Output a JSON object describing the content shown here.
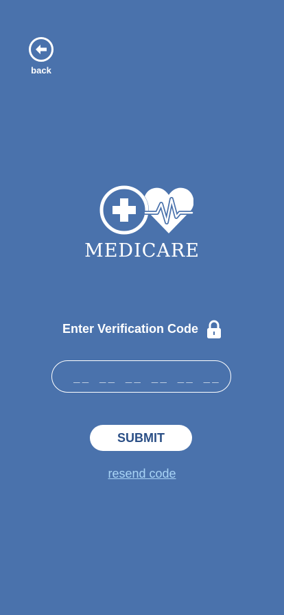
{
  "colors": {
    "background": "#4a72ac",
    "foreground": "#ffffff",
    "button_text": "#2b4f86",
    "link": "#a8d4f6"
  },
  "header": {
    "back_icon": "arrow-left-circle-icon",
    "back_label": "back"
  },
  "logo": {
    "icon": "medical-cross-heart-pulse-icon",
    "text": "MEDICARE"
  },
  "verification": {
    "label": "Enter Verification Code",
    "lock_icon": "lock-icon",
    "code_placeholder": "__ __ __ __ __ __"
  },
  "actions": {
    "submit_label": "SUBMIT",
    "resend_label": "resend code"
  }
}
